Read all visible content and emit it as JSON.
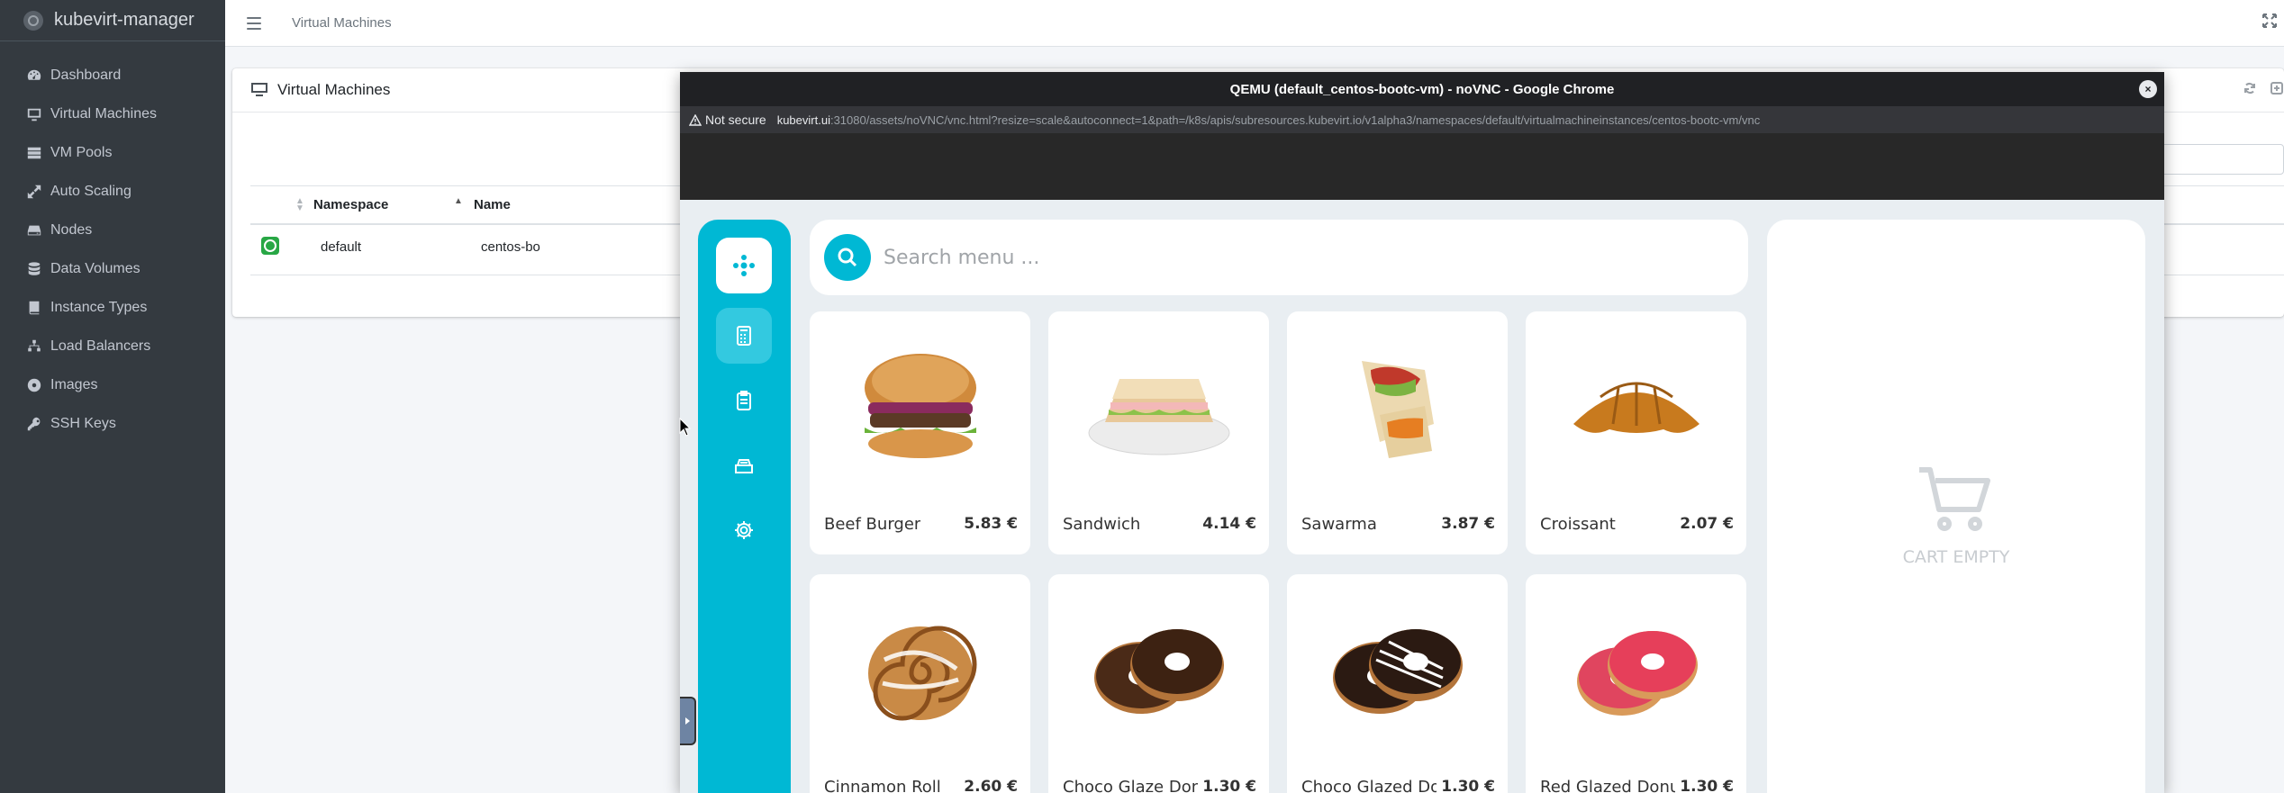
{
  "brand": {
    "name": "kubevirt-manager"
  },
  "sidebar": {
    "items": [
      {
        "label": "Dashboard",
        "icon": "dashboard-icon"
      },
      {
        "label": "Virtual Machines",
        "icon": "desktop-icon"
      },
      {
        "label": "VM Pools",
        "icon": "server-icon"
      },
      {
        "label": "Auto Scaling",
        "icon": "expand-icon"
      },
      {
        "label": "Nodes",
        "icon": "hdd-icon"
      },
      {
        "label": "Data Volumes",
        "icon": "database-icon"
      },
      {
        "label": "Instance Types",
        "icon": "book-icon"
      },
      {
        "label": "Load Balancers",
        "icon": "sitemap-icon"
      },
      {
        "label": "Images",
        "icon": "compact-disc-icon"
      },
      {
        "label": "SSH Keys",
        "icon": "key-icon"
      }
    ]
  },
  "topbar": {
    "link": "Virtual Machines"
  },
  "card": {
    "title": "Virtual Machines",
    "columns": {
      "namespace": "Namespace",
      "name": "Name"
    },
    "rows": [
      {
        "namespace": "default",
        "name": "centos-bo"
      }
    ]
  },
  "popup": {
    "title": "QEMU (default_centos-bootc-vm) - noVNC - Google Chrome",
    "close": "×",
    "not_secure": "Not secure",
    "url_host": "kubevirt.ui",
    "url_rest": ":31080/assets/noVNC/vnc.html?resize=scale&autoconnect=1&path=/k8s/apis/subresources.kubevirt.io/v1alpha3/namespaces/default/virtualmachineinstances/centos-bootc-vm/vnc"
  },
  "pos": {
    "search_placeholder": "Search menu ...",
    "cart_empty": "CART EMPTY",
    "products": [
      {
        "name": "Beef Burger",
        "price": "5.83 €",
        "icon": "burger-image"
      },
      {
        "name": "Sandwich",
        "price": "4.14 €",
        "icon": "sandwich-image"
      },
      {
        "name": "Sawarma",
        "price": "3.87 €",
        "icon": "shawarma-image"
      },
      {
        "name": "Croissant",
        "price": "2.07 €",
        "icon": "croissant-image"
      },
      {
        "name": "Cinnamon Roll",
        "price": "2.60 €",
        "icon": "cinnamon-roll-image"
      },
      {
        "name": "Choco Glaze Don",
        "price": "1.30 €",
        "icon": "choco-donut-image"
      },
      {
        "name": "Choco Glazed Do",
        "price": "1.30 €",
        "icon": "choco-glazed-donut-image"
      },
      {
        "name": "Red Glazed Donut",
        "price": "1.30 €",
        "icon": "red-donut-image"
      }
    ]
  },
  "colors": {
    "accent": "#00b8d4",
    "sidebar_bg": "#343a40",
    "status_ok": "#28a745"
  }
}
